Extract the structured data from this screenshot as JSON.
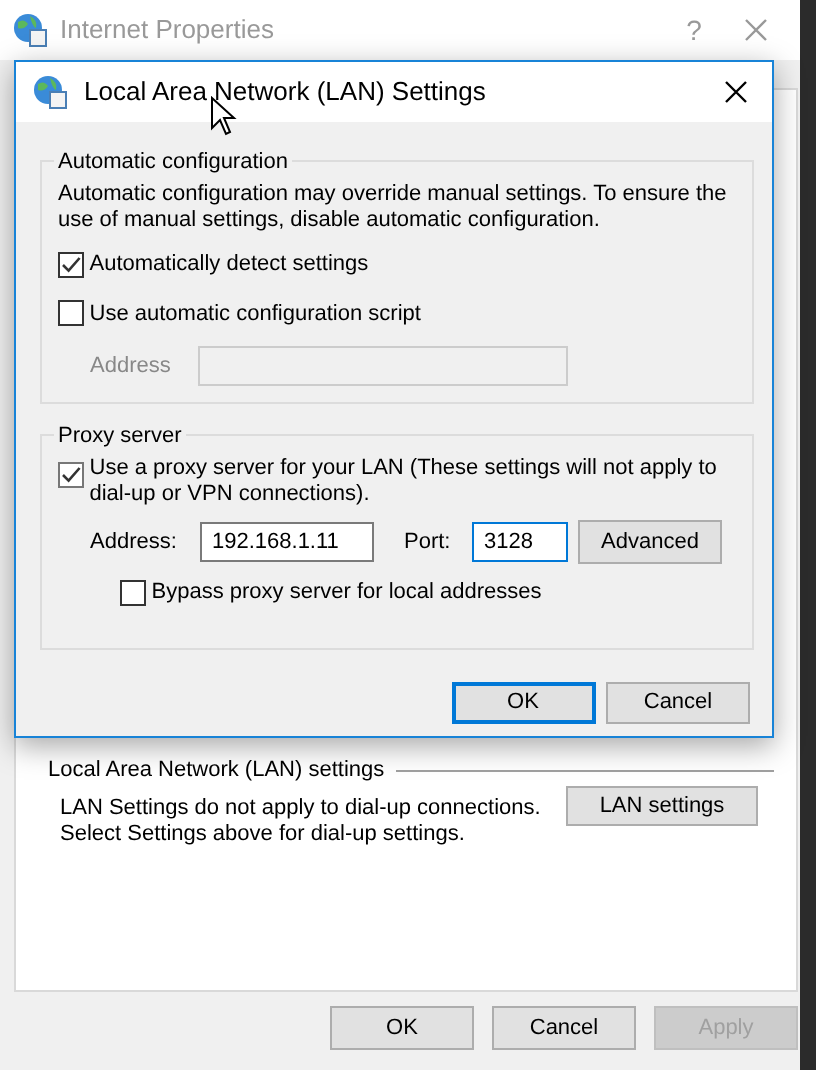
{
  "window": {
    "title": "Internet Properties",
    "help": "?"
  },
  "dialog": {
    "title": "Local Area Network (LAN) Settings",
    "auto_config": {
      "legend": "Automatic configuration",
      "description": "Automatic configuration may override manual settings.  To ensure the use of manual settings, disable automatic configuration.",
      "options": [
        {
          "label": "Automatically detect settings",
          "checked": true
        },
        {
          "label": "Use automatic configuration script",
          "checked": false
        }
      ],
      "address": {
        "label": "Address",
        "disabled": true
      }
    },
    "proxy": {
      "legend": "Proxy server",
      "use_proxy": {
        "label": "Use a proxy server for your LAN (These settings will not apply to dial-up or VPN connections).",
        "checked": true
      },
      "address": {
        "label": "Address:",
        "value": "192.168.1.11"
      },
      "port": {
        "label": "Port:",
        "value": "3128",
        "focused": true
      },
      "advanced": "Advanced",
      "bypass": {
        "label": "Bypass proxy server for local addresses",
        "checked": false
      }
    },
    "buttons": [
      {
        "label": "OK",
        "default": true
      },
      {
        "label": "Cancel",
        "default": false
      }
    ]
  },
  "lan_section": {
    "legend": "Local Area Network (LAN) settings",
    "description": "LAN Settings do not apply to dial-up connections.\nSelect Settings above for dial-up settings.",
    "button": "LAN settings"
  },
  "buttons": [
    {
      "label": "OK",
      "disabled": false
    },
    {
      "label": "Cancel",
      "disabled": false
    },
    {
      "label": "Apply",
      "disabled": true
    }
  ]
}
